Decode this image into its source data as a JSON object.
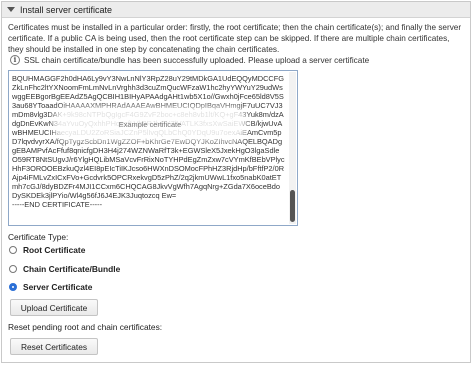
{
  "section": {
    "title": "Install server certificate"
  },
  "description": "Certificates must be installed in a particular order: firstly, the root certificate; then the chain certificate(s); and finally the server certificate. If a public CA is being used, then the root certificate step can be skipped. If there are multiple chain certificates, they should be installed in one step by concatenating the chain certificates.",
  "notice": "SSL chain certificate/bundle has been successfully uploaded. Please upload a server certificate",
  "certificate_text": "BQUHMAGGF2h0dHA6Ly9vY3NwLnNlY3RpZ28uY29tMDkGA1UdEQQyMDCCFGZkLnFhc2ltYXNoomFmLmNvLnVrghh3d3cuZmQucWFzaW1hc2hyYWYuY29udWswggEEBgorBgEEAdZ5AgQCBIH1BIHyAPAAdgAHt1wb5X1o//Gwxh0jFce65ld8V5S3au68YToaadOiHAAAAXMPHRAdAAAEAwBHMEUCIQDpIBqaVHmgjF7uUC7VJ3mDm8vlg3DAK+9k98cNTPbQgIgcF4G9ZvF2boc+c8eh8vb1lt/KQ+gF43Yuk8m/dzAdgDnEvKwN34aYvuOyQxhhPHqezfLVh0RJlvFYZlVATLK3fxsXwSaiEWCB/kjwUvAwBHMEUCIHaecyaLDU2ZoRSiaJCZnP5lIvqQLbChQ0YDqU9u7oexAiEAmCvm5pD7lqvdvyrXA/fQpTygzScbDn1WgZZOF+bKhrGe7EwDQYJKoZIhvcNAQELBQADggEBAMPvfAcFfuf8qnicfgDH3H4j274WZNWaRfT3k+EGWSleX5JxekHgO3lgaSdleO59RT8NtSUgvJ/r6YlgHQLibMSaVcvFrRixNoTYHPdEgZmZxw7cVYmKfBEbVPlycHhF3OROOEBzkuQzl4EI8pEIcTiIKJcso6HWXnDSOMocFPhHZ3RjdHp/bFftfP2/0RAjp4iFMLvZxICxFVo+Gcdvrk5OPCRxekvgD5zPhZ/2q2jkmUWwL1fxo5nabK0atETmh7cGJ/8dyBDZFr4MJI1CCxm6CHQCAG8JkvVgWfh7AgqNrg+ZGda7X6oceBdoDySKDEk3jlPYio/Wl4g56fJ6J4EJK3Juqtozcq Ew=\n-----END CERTIFICATE-----",
  "overlay_label": "Example certificate",
  "certificate_type": {
    "label": "Certificate Type:",
    "options": [
      {
        "label": "Root Certificate",
        "selected": false
      },
      {
        "label": "Chain Certificate/Bundle",
        "selected": false
      },
      {
        "label": "Server Certificate",
        "selected": true
      }
    ]
  },
  "buttons": {
    "upload": "Upload Certificate",
    "reset": "Reset Certificates"
  },
  "reset_label": "Reset pending root and chain certificates:",
  "colors": {
    "accent": "#2b6fd6",
    "header_bg": "#ececec",
    "textarea_border": "#8fa8c8"
  }
}
